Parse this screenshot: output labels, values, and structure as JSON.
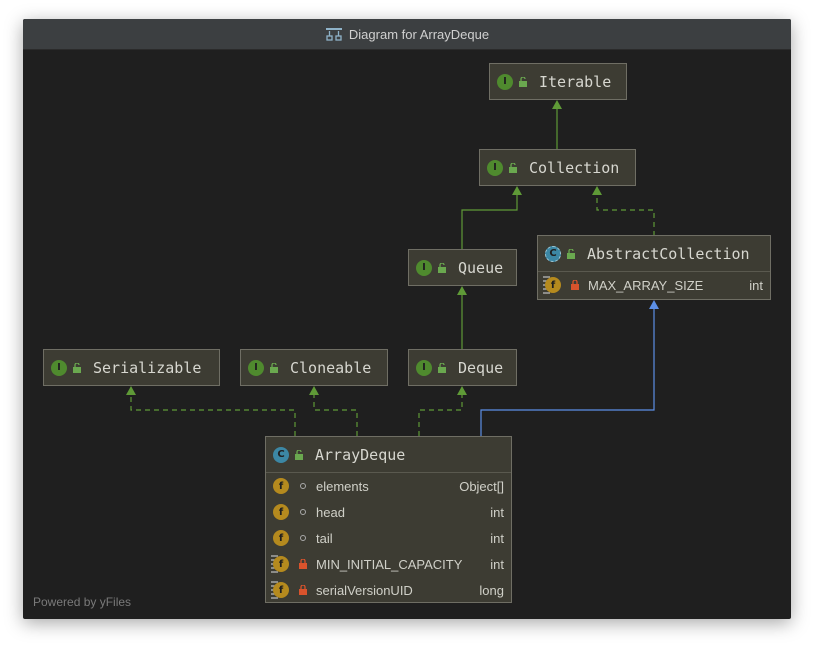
{
  "window": {
    "title": "Diagram for ArrayDeque"
  },
  "watermark": "Powered by yFiles",
  "colors": {
    "background": "#1f1f1f",
    "node_fill": "#3d3c33",
    "interface_badge": "#4f8a2e",
    "class_badge": "#3c87a4",
    "field_badge": "#b58a1e",
    "extends_arrow": "#5f9a37",
    "implements_arrow": "#5f9a37",
    "class_extends_arrow": "#5c8fe6"
  },
  "nodes": {
    "iterable": {
      "kind": "interface",
      "badge": "I",
      "name": "Iterable"
    },
    "collection": {
      "kind": "interface",
      "badge": "I",
      "name": "Collection"
    },
    "queue": {
      "kind": "interface",
      "badge": "I",
      "name": "Queue"
    },
    "abstract_collection": {
      "kind": "abstract class",
      "badge": "C",
      "name": "AbstractCollection",
      "fields": [
        {
          "badge": "f",
          "visibility": "private",
          "static": true,
          "name": "MAX_ARRAY_SIZE",
          "type": "int"
        }
      ]
    },
    "serializable": {
      "kind": "interface",
      "badge": "I",
      "name": "Serializable"
    },
    "cloneable": {
      "kind": "interface",
      "badge": "I",
      "name": "Cloneable"
    },
    "deque": {
      "kind": "interface",
      "badge": "I",
      "name": "Deque"
    },
    "array_deque": {
      "kind": "class",
      "badge": "C",
      "name": "ArrayDeque",
      "fields": [
        {
          "badge": "f",
          "visibility": "package",
          "static": false,
          "name": "elements",
          "type": "Object[]"
        },
        {
          "badge": "f",
          "visibility": "package",
          "static": false,
          "name": "head",
          "type": "int"
        },
        {
          "badge": "f",
          "visibility": "package",
          "static": false,
          "name": "tail",
          "type": "int"
        },
        {
          "badge": "f",
          "visibility": "private",
          "static": true,
          "name": "MIN_INITIAL_CAPACITY",
          "type": "int"
        },
        {
          "badge": "f",
          "visibility": "private",
          "static": true,
          "name": "serialVersionUID",
          "type": "long"
        }
      ]
    }
  },
  "edges": [
    {
      "from": "Collection",
      "to": "Iterable",
      "relation": "extends",
      "style": "solid"
    },
    {
      "from": "Queue",
      "to": "Collection",
      "relation": "extends",
      "style": "solid"
    },
    {
      "from": "AbstractCollection",
      "to": "Collection",
      "relation": "implements",
      "style": "dashed"
    },
    {
      "from": "Deque",
      "to": "Queue",
      "relation": "extends",
      "style": "solid"
    },
    {
      "from": "ArrayDeque",
      "to": "Serializable",
      "relation": "implements",
      "style": "dashed"
    },
    {
      "from": "ArrayDeque",
      "to": "Cloneable",
      "relation": "implements",
      "style": "dashed"
    },
    {
      "from": "ArrayDeque",
      "to": "Deque",
      "relation": "implements",
      "style": "dashed"
    },
    {
      "from": "ArrayDeque",
      "to": "AbstractCollection",
      "relation": "extends",
      "style": "solid"
    }
  ]
}
